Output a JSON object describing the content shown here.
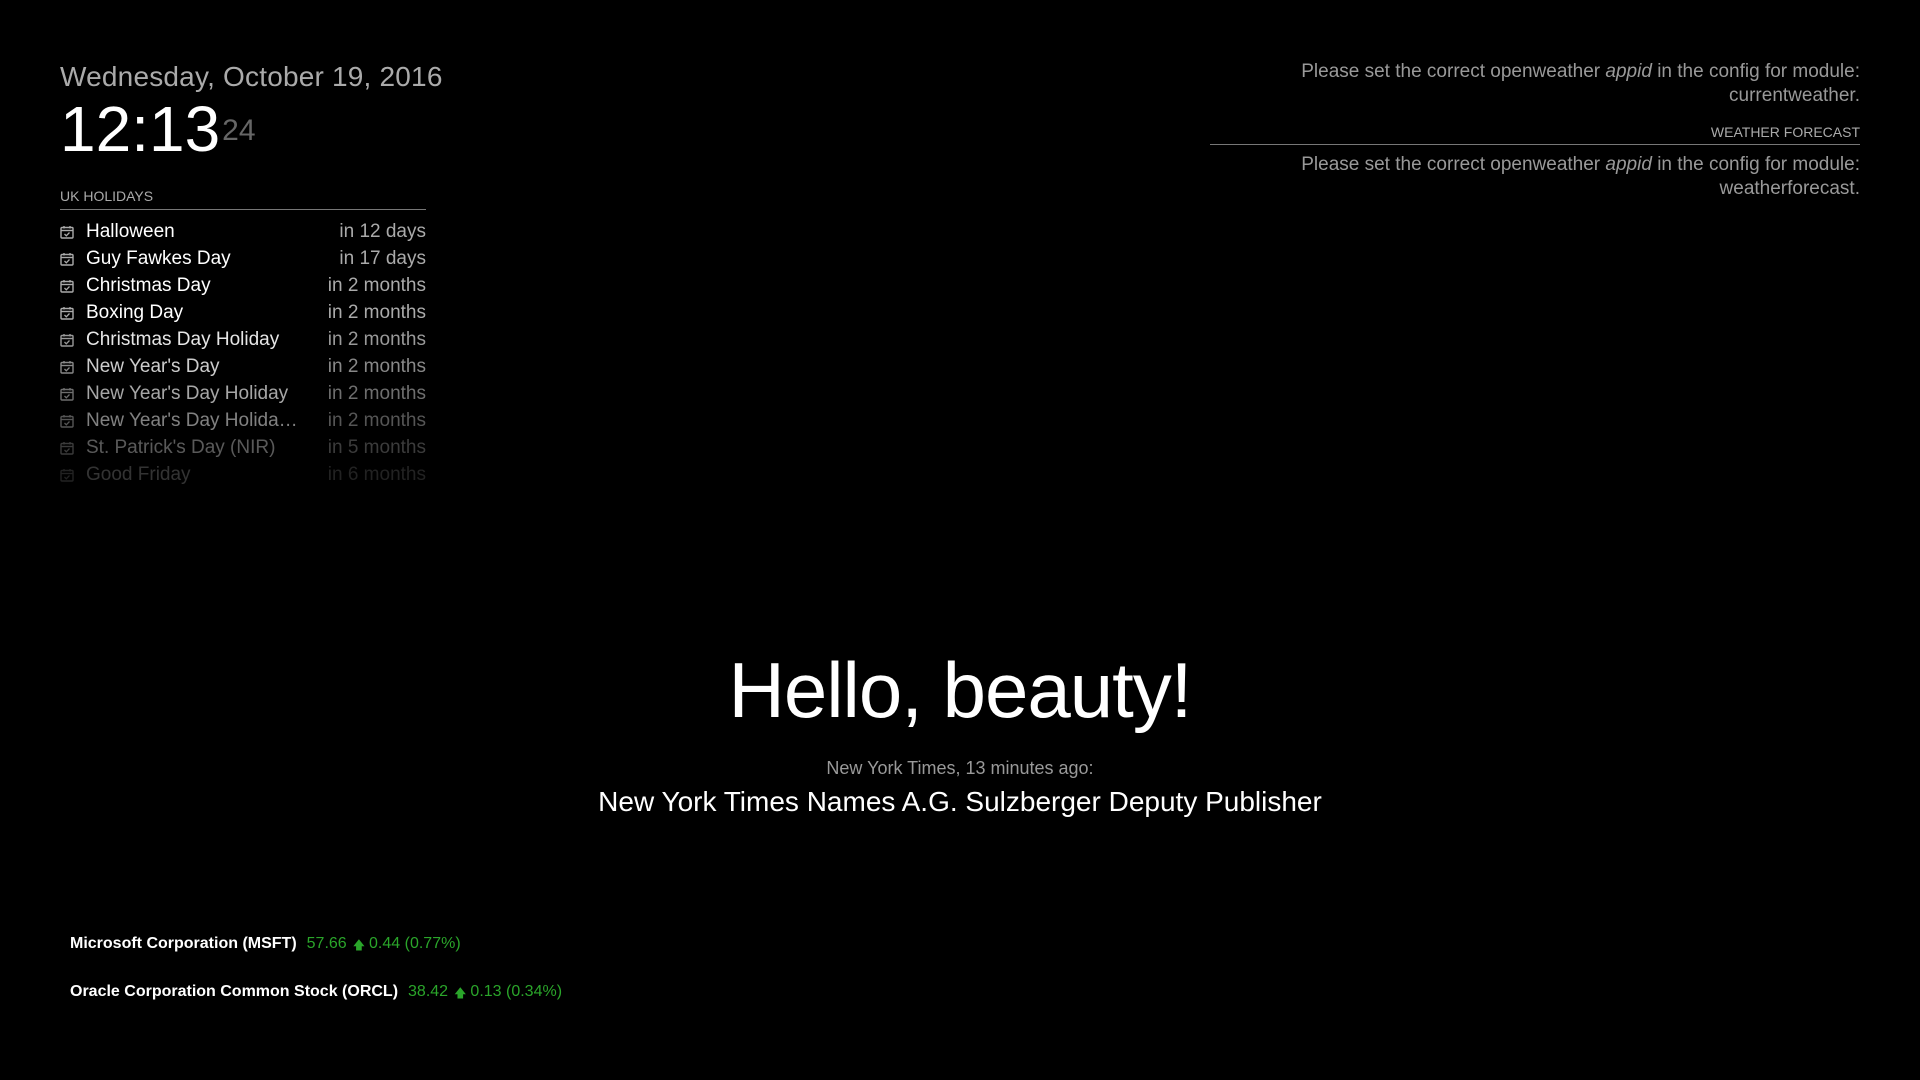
{
  "clock": {
    "date": "Wednesday, October 19, 2016",
    "time": "12:13",
    "seconds": "24"
  },
  "calendar": {
    "header": "UK Holidays",
    "icon": "calendar-icon",
    "events": [
      {
        "title": "Halloween",
        "time": "in 12 days",
        "opacity": 1.0
      },
      {
        "title": "Guy Fawkes Day",
        "time": "in 17 days",
        "opacity": 1.0
      },
      {
        "title": "Christmas Day",
        "time": "in 2 months",
        "opacity": 1.0
      },
      {
        "title": "Boxing Day",
        "time": "in 2 months",
        "opacity": 1.0
      },
      {
        "title": "Christmas Day Holiday",
        "time": "in 2 months",
        "opacity": 0.9
      },
      {
        "title": "New Year's Day",
        "time": "in 2 months",
        "opacity": 0.8
      },
      {
        "title": "New Year's Day Holiday",
        "time": "in 2 months",
        "opacity": 0.65
      },
      {
        "title": "New Year's Day Holiday (S…",
        "time": "in 2 months",
        "opacity": 0.5
      },
      {
        "title": "St. Patrick's Day (NIR)",
        "time": "in 5 months",
        "opacity": 0.35
      },
      {
        "title": "Good Friday",
        "time": "in 6 months",
        "opacity": 0.2
      }
    ]
  },
  "weather": {
    "current_prefix": "Please set the correct openweather ",
    "current_em": "appid",
    "current_suffix": " in the config for module: currentweather.",
    "forecast_header": "Weather Forecast",
    "forecast_prefix": "Please set the correct openweather ",
    "forecast_em": "appid",
    "forecast_suffix": " in the config for module: weatherforecast."
  },
  "compliment": "Hello, beauty!",
  "news": {
    "source": "New York Times, 13 minutes ago:",
    "title": "New York Times Names A.G. Sulzberger Deputy Publisher"
  },
  "stocks": [
    {
      "name": "Microsoft Corporation (MSFT)",
      "price": "57.66",
      "arrow": "up-arrow-icon",
      "change": "0.44 (0.77%)"
    },
    {
      "name": "Oracle Corporation Common Stock (ORCL)",
      "price": "38.42",
      "arrow": "up-arrow-icon",
      "change": "0.13 (0.34%)"
    }
  ],
  "colors": {
    "background": "#000000",
    "text_bright": "#ffffff",
    "text_dim": "#aaaaaa",
    "stock_up": "#2aa52a"
  }
}
